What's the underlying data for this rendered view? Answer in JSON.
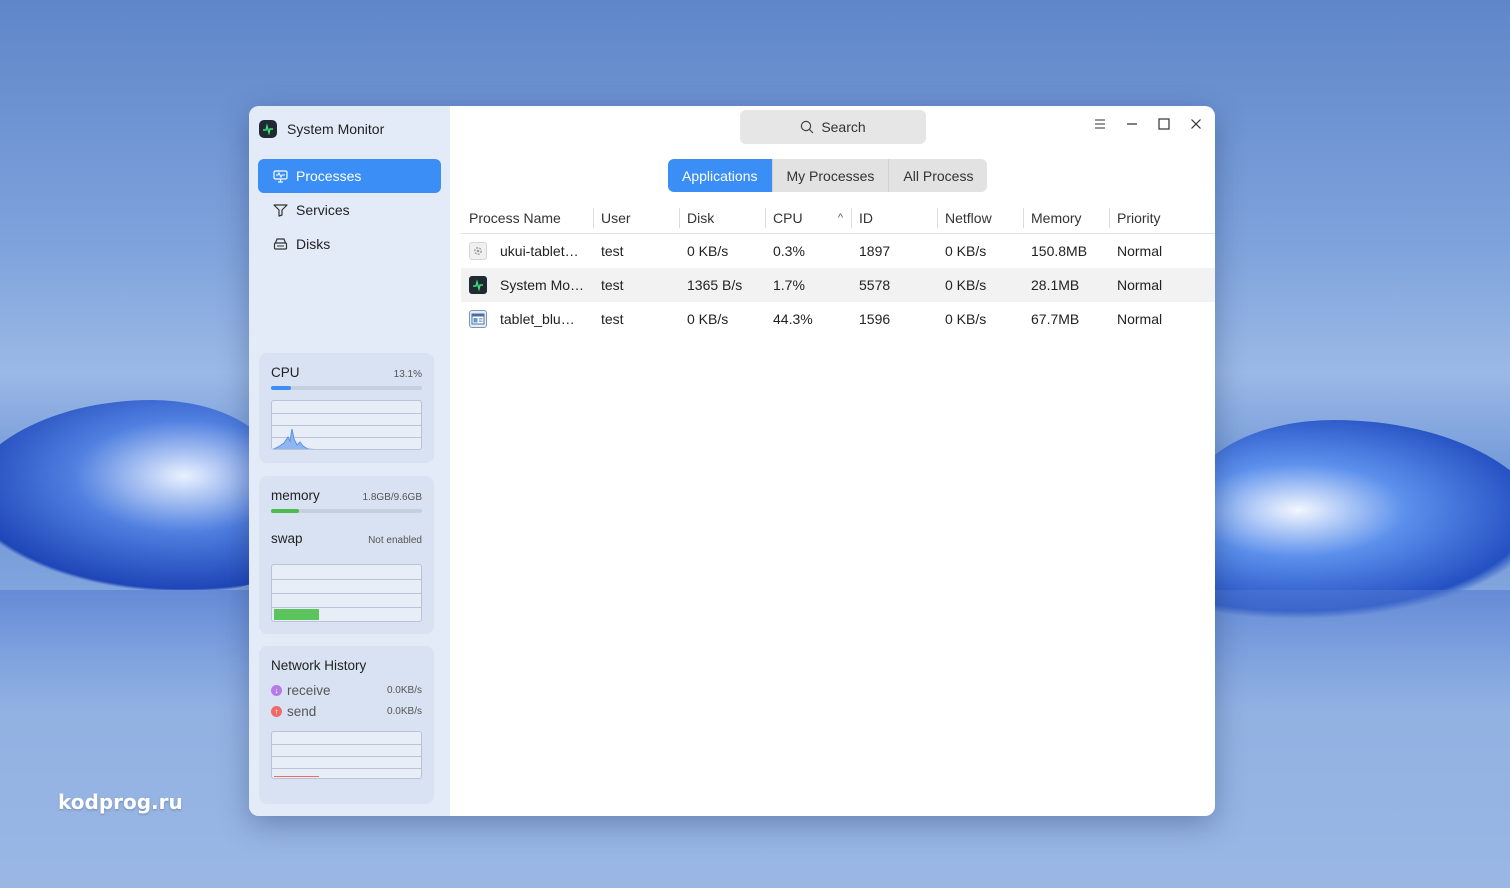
{
  "app": {
    "title": "System Monitor"
  },
  "nav": [
    {
      "label": "Processes",
      "icon": "monitor-icon",
      "active": true
    },
    {
      "label": "Services",
      "icon": "services-icon",
      "active": false
    },
    {
      "label": "Disks",
      "icon": "disk-icon",
      "active": false
    }
  ],
  "cpu_card": {
    "title": "CPU",
    "value": "13.1%",
    "usage_fraction": 0.131
  },
  "memory_card": {
    "memory_title": "memory",
    "memory_value": "1.8GB/9.6GB",
    "memory_fraction": 0.1875,
    "swap_title": "swap",
    "swap_value": "Not enabled"
  },
  "network_card": {
    "title": "Network History",
    "receive_label": "receive",
    "receive_value": "0.0KB/s",
    "send_label": "send",
    "send_value": "0.0KB/s"
  },
  "search": {
    "label": "Search"
  },
  "tabs": [
    {
      "label": "Applications",
      "active": true
    },
    {
      "label": "My Processes",
      "active": false
    },
    {
      "label": "All Process",
      "active": false
    }
  ],
  "table": {
    "headers": [
      "Process Name",
      "User",
      "Disk",
      "CPU",
      "ID",
      "Netflow",
      "Memory",
      "Priority"
    ],
    "rows": [
      {
        "name": "ukui-tablet…",
        "user": "test",
        "disk": "0 KB/s",
        "cpu": "0.3%",
        "id": "1897",
        "netflow": "0 KB/s",
        "memory": "150.8MB",
        "priority": "Normal",
        "icon": "gear-icon"
      },
      {
        "name": "System Mo…",
        "user": "test",
        "disk": "1365 B/s",
        "cpu": "1.7%",
        "id": "5578",
        "netflow": "0 KB/s",
        "memory": "28.1MB",
        "priority": "Normal",
        "icon": "system-monitor-icon"
      },
      {
        "name": "tablet_blu…",
        "user": "test",
        "disk": "0 KB/s",
        "cpu": "44.3%",
        "id": "1596",
        "netflow": "0 KB/s",
        "memory": "67.7MB",
        "priority": "Normal",
        "icon": "window-app-icon"
      }
    ]
  },
  "colors": {
    "accent": "#3a8ef6",
    "memory_bar": "#4cbc4c",
    "receive": "#b57be6",
    "send": "#f06a6a"
  },
  "watermark": "kodprog.ru"
}
